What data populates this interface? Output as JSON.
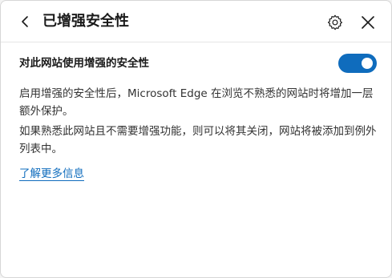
{
  "header": {
    "title": "已增强安全性",
    "back_icon": "chevron-left-icon",
    "settings_icon": "gear-icon",
    "close_icon": "close-icon"
  },
  "setting": {
    "label": "对此网站使用增强的安全性",
    "toggle_state": "on",
    "toggle_color": "#0f6cbd"
  },
  "body": {
    "paragraph1": "启用增强的安全性后，Microsoft Edge 在浏览不熟悉的网站时将增加一层额外保护。",
    "paragraph2": "如果熟悉此网站且不需要增强功能，则可以将其关闭，网站将被添加到例外列表中。",
    "learn_more": "了解更多信息"
  }
}
